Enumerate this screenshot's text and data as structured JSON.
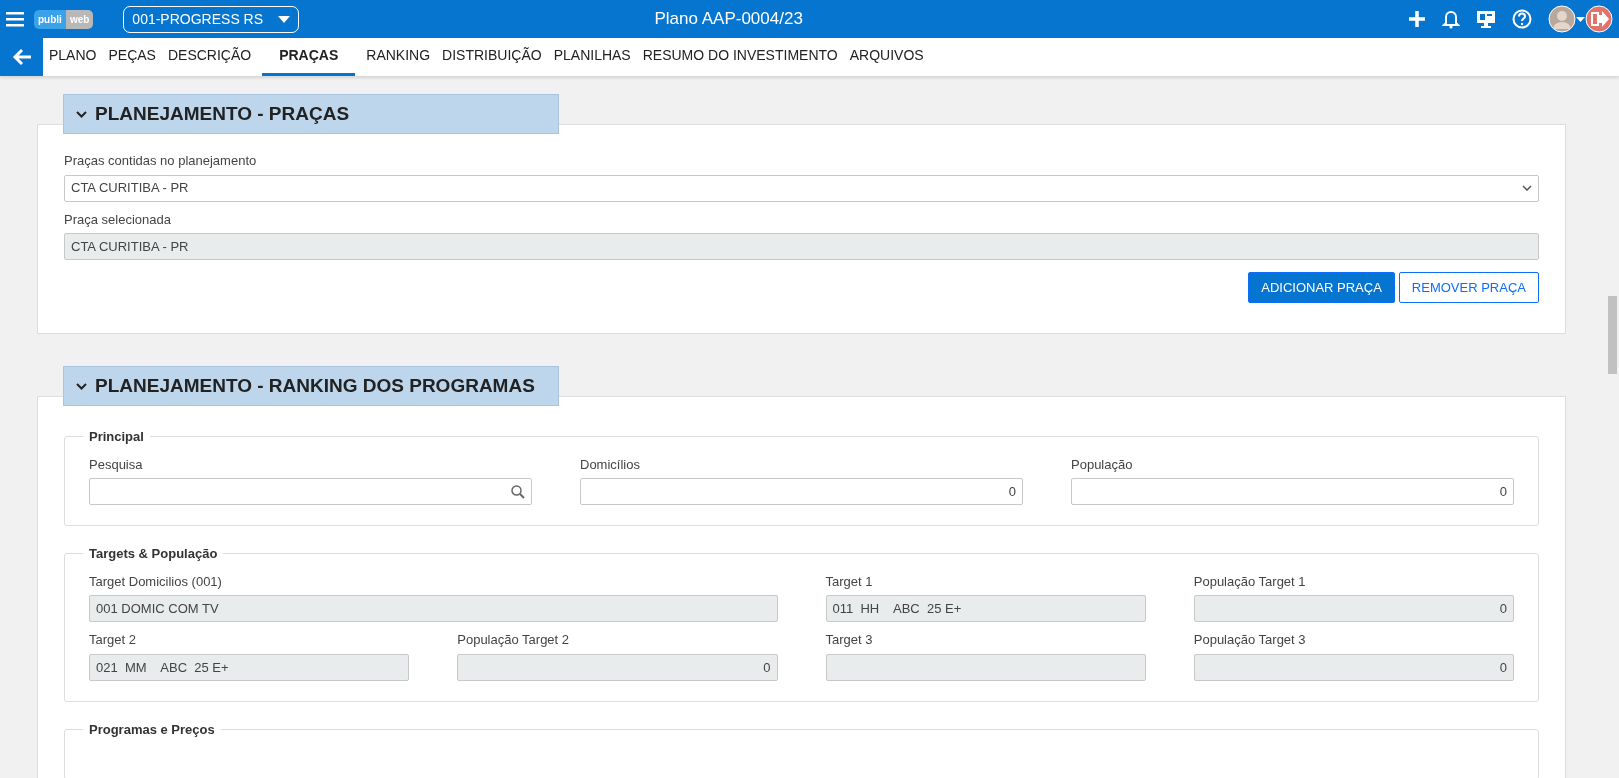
{
  "topbar": {
    "logo": [
      "publi",
      "web"
    ],
    "company_select": "001-PROGRESS RS",
    "title": "Plano AAP-0004/23"
  },
  "tabs": [
    {
      "label": "PLANO",
      "selected": false
    },
    {
      "label": "PEÇAS",
      "selected": false
    },
    {
      "label": "DESCRIÇÃO",
      "selected": false
    },
    {
      "label": "PRAÇAS",
      "selected": true
    },
    {
      "label": "RANKING",
      "selected": false
    },
    {
      "label": "DISTRIBUIÇÃO",
      "selected": false
    },
    {
      "label": "PLANILHAS",
      "selected": false
    },
    {
      "label": "RESUMO DO INVESTIMENTO",
      "selected": false
    },
    {
      "label": "ARQUIVOS",
      "selected": false
    }
  ],
  "pracas_section": {
    "title": "PLANEJAMENTO - PRAÇAS",
    "fields": [
      {
        "label": "Praças contidas no planejamento",
        "value": "CTA CURITIBA - PR",
        "kind": "select"
      },
      {
        "label": "Praça selecionada",
        "value": "CTA CURITIBA - PR",
        "kind": "readonly"
      }
    ],
    "buttons": [
      {
        "label": "ADICIONAR PRAÇA",
        "kind": "primary"
      },
      {
        "label": "REMOVER PRAÇA",
        "kind": "outline"
      }
    ]
  },
  "ranking_section": {
    "title": "PLANEJAMENTO - RANKING DOS PROGRAMAS",
    "groups": [
      {
        "legend": "Principal",
        "fields": [
          {
            "label": "Pesquisa",
            "kind": "search"
          },
          {
            "label": "Domicílios",
            "value": "0",
            "kind": "number"
          },
          {
            "label": "População",
            "value": "0",
            "kind": "number"
          }
        ]
      },
      {
        "legend": "Targets & População",
        "fields": [
          {
            "label": "Target Domicilios (001)",
            "value": "001 DOMIC COM TV",
            "kind": "readonly"
          },
          {
            "label": "Target 1",
            "value": "011  HH    ABC  25 E+",
            "kind": "readonly"
          },
          {
            "label": "População Target 1",
            "value": "0",
            "kind": "readonly-number"
          },
          {
            "label": "Target 2",
            "value": "021  MM    ABC  25 E+",
            "kind": "readonly"
          },
          {
            "label": "População Target 2",
            "value": "0",
            "kind": "readonly-number"
          },
          {
            "label": "Target 3",
            "kind": "readonly"
          },
          {
            "label": "População Target 3",
            "value": "0",
            "kind": "readonly-number"
          }
        ]
      },
      {
        "legend": "Programas e Preços"
      }
    ]
  }
}
